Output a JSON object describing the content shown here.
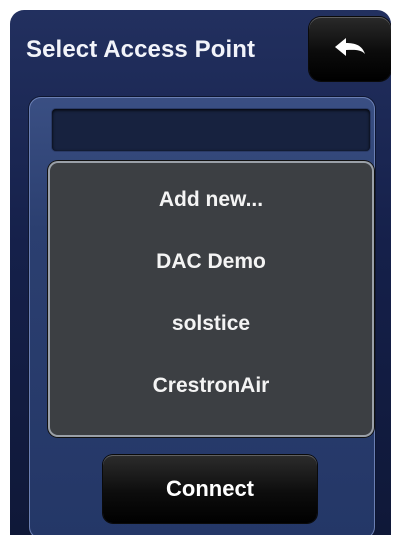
{
  "header": {
    "title": "Select Access Point",
    "back_icon": "back-arrow-icon"
  },
  "ssid_field": {
    "value": ""
  },
  "access_points": [
    {
      "label": "Add new..."
    },
    {
      "label": "DAC Demo"
    },
    {
      "label": "solstice"
    },
    {
      "label": "CrestronAir"
    }
  ],
  "actions": {
    "connect_label": "Connect"
  },
  "colors": {
    "background": "#15204a",
    "panel": "#2b3f70",
    "list_background": "#3c3f43",
    "button": "#0d0d0d",
    "text": "#ffffff"
  }
}
